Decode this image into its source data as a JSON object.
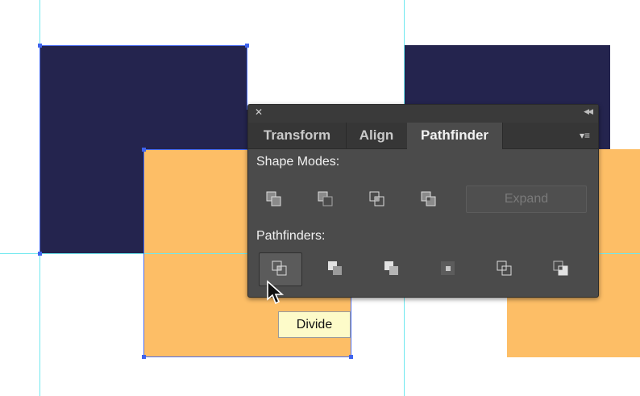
{
  "colors": {
    "navy": "#24244e",
    "orange": "#fdbe66",
    "guide": "#6fe8ef",
    "selection": "#4a6df0",
    "panel_bg": "#4b4b4b",
    "tooltip_bg": "#fdfbc9"
  },
  "panel": {
    "close_icon": "close-icon",
    "collapse_icon": "double-chevron-icon",
    "menu_icon": "panel-menu-icon",
    "tabs": [
      {
        "label": "Transform",
        "active": false
      },
      {
        "label": "Align",
        "active": false
      },
      {
        "label": "Pathfinder",
        "active": true
      }
    ],
    "shape_modes": {
      "label": "Shape Modes:",
      "buttons": [
        "unite-icon",
        "minus-front-icon",
        "intersect-icon",
        "exclude-icon"
      ],
      "expand_label": "Expand"
    },
    "pathfinders": {
      "label": "Pathfinders:",
      "buttons": [
        "divide-icon",
        "trim-icon",
        "merge-icon",
        "crop-icon",
        "outline-icon",
        "minus-back-icon"
      ]
    }
  },
  "tooltip": {
    "text": "Divide"
  }
}
